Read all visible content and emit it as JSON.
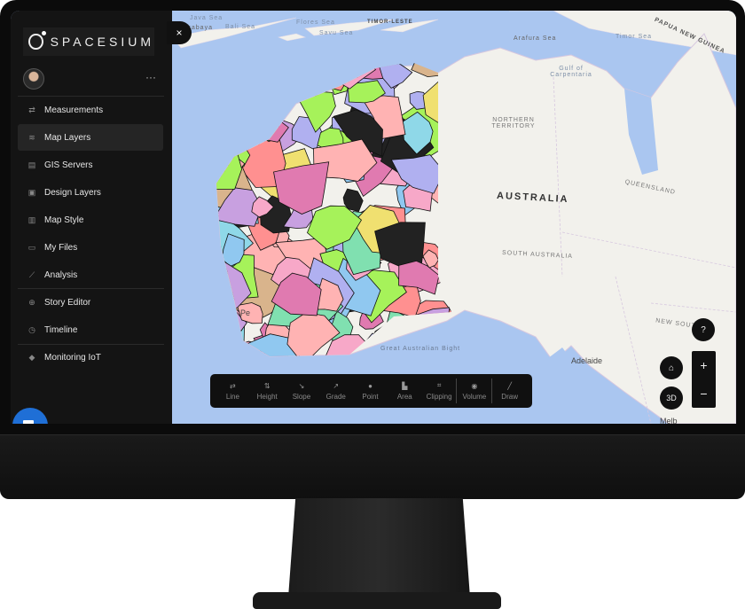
{
  "app": {
    "logo_text": "SPACESIUM"
  },
  "sidebar": {
    "more_label": "···",
    "items": [
      {
        "label": "Measurements",
        "icon": "arrows-swap-icon"
      },
      {
        "label": "Map Layers",
        "icon": "layers-icon",
        "active": true
      },
      {
        "label": "GIS Servers",
        "icon": "server-icon"
      },
      {
        "label": "Design Layers",
        "icon": "database-icon"
      },
      {
        "label": "Map Style",
        "icon": "map-icon"
      },
      {
        "label": "My Files",
        "icon": "folder-icon"
      },
      {
        "label": "Analysis",
        "icon": "chart-line-icon"
      },
      {
        "label": "Story Editor",
        "icon": "plus-circle-icon"
      },
      {
        "label": "Timeline",
        "icon": "clock-icon"
      },
      {
        "label": "Monitoring IoT",
        "icon": "sensor-icon"
      }
    ]
  },
  "close_label": "×",
  "map": {
    "labels": {
      "timor_sea": "Timor Sea",
      "savu_sea": "Savu Sea",
      "flores_sea": "Flores Sea",
      "java_sea": "Java Sea",
      "bali_sea": "Bali Sea",
      "surabaya": "Surabaya",
      "timor_leste": "TIMOR-LESTE",
      "arafura_sea": "Arafura Sea",
      "gulf": "Gulf of Carpentaria",
      "png": "PAPUA NEW GUINEA",
      "nt": "NORTHERN TERRITORY",
      "australia": "AUSTRALIA",
      "queensland": "QUEENSLAND",
      "sa": "SOUTH AUSTRALIA",
      "nsw": "NEW SOUTH",
      "bight": "Great Australian Bight",
      "adelaide": "Adelaide",
      "perth": "Pe",
      "melbourne": "Melb"
    },
    "colors": {
      "ocean": "#aac6f0",
      "land": "#f2f1ec"
    }
  },
  "toolbar": {
    "tools": [
      {
        "label": "Line",
        "icon": "line-measure-icon"
      },
      {
        "label": "Height",
        "icon": "height-icon"
      },
      {
        "label": "Slope",
        "icon": "slope-icon"
      },
      {
        "label": "Grade",
        "icon": "grade-icon"
      },
      {
        "label": "Point",
        "icon": "point-icon"
      },
      {
        "label": "Area",
        "icon": "area-icon"
      },
      {
        "label": "Clipping",
        "icon": "clipping-icon"
      },
      {
        "label": "Volume",
        "icon": "volume-icon"
      },
      {
        "label": "Draw",
        "icon": "draw-icon"
      }
    ]
  },
  "controls": {
    "help": "?",
    "home": "⌂",
    "mode_3d": "3D",
    "zoom_in": "+",
    "zoom_out": "−"
  }
}
